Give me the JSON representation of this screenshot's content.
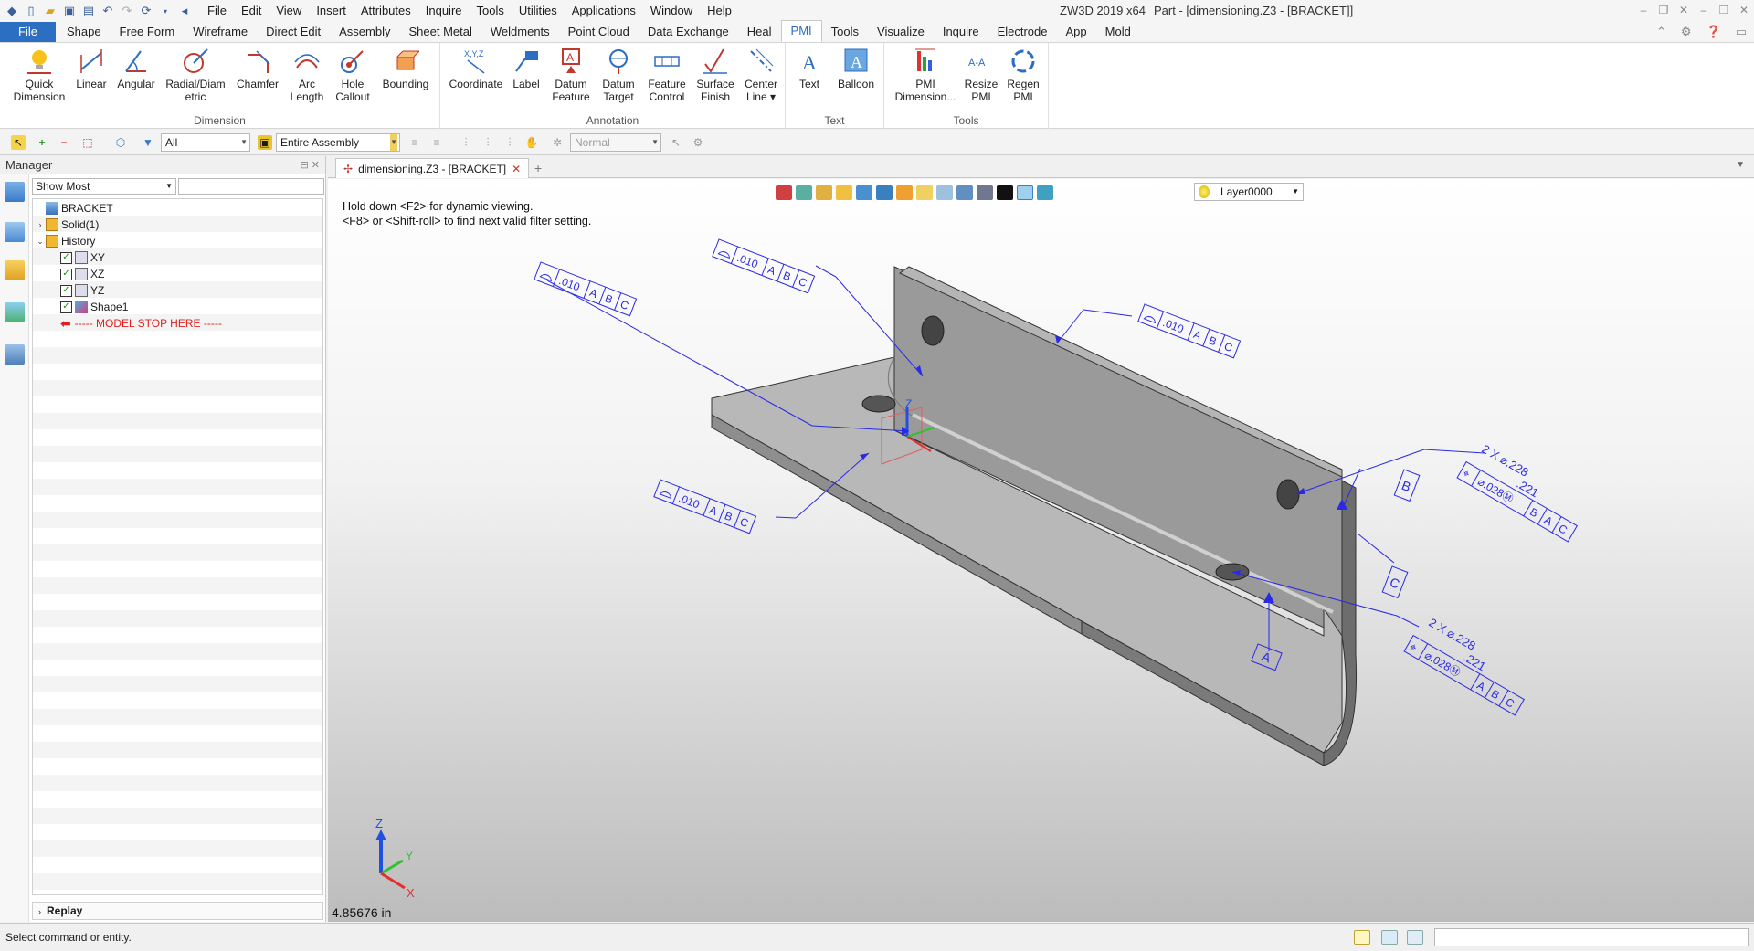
{
  "titlebar": {
    "menu": [
      "File",
      "Edit",
      "View",
      "Insert",
      "Attributes",
      "Inquire",
      "Tools",
      "Utilities",
      "Applications",
      "Window",
      "Help"
    ],
    "app_name": "ZW3D 2019  x64",
    "doc_title": "Part - [dimensioning.Z3 - [BRACKET]]"
  },
  "tabs": [
    "File",
    "Shape",
    "Free Form",
    "Wireframe",
    "Direct Edit",
    "Assembly",
    "Sheet Metal",
    "Weldments",
    "Point Cloud",
    "Data Exchange",
    "Heal",
    "PMI",
    "Tools",
    "Visualize",
    "Inquire",
    "Electrode",
    "App",
    "Mold"
  ],
  "active_tab": "PMI",
  "ribbon": {
    "dimension": {
      "label": "Dimension",
      "buttons": [
        "Quick\nDimension",
        "Linear",
        "Angular",
        "Radial/Diam\netric",
        "Chamfer",
        "Arc\nLength",
        "Hole\nCallout",
        "Bounding"
      ]
    },
    "annotation": {
      "label": "Annotation",
      "buttons": [
        "Coordinate",
        "Label",
        "Datum\nFeature",
        "Datum\nTarget",
        "Feature\nControl",
        "Surface\nFinish",
        "Center\nLine ▾"
      ]
    },
    "text": {
      "label": "Text",
      "buttons": [
        "Text",
        "Balloon"
      ]
    },
    "tools": {
      "label": "Tools",
      "buttons": [
        "PMI\nDimension...",
        "Resize\nPMI",
        "Regen\nPMI"
      ]
    }
  },
  "toolbar": {
    "filter_value": "All",
    "assembly_value": "Entire Assembly",
    "render_value": "Normal"
  },
  "manager": {
    "title": "Manager",
    "filter": "Show Most",
    "tree": {
      "root": "BRACKET",
      "solid": "Solid(1)",
      "history": "History",
      "items": [
        "XY",
        "XZ",
        "YZ",
        "Shape1"
      ],
      "stop_marker": "----- MODEL STOP HERE -----"
    },
    "replay": "Replay"
  },
  "document": {
    "tab_label": "dimensioning.Z3 - [BRACKET]"
  },
  "viewport": {
    "hint_line1": "Hold down <F2> for dynamic viewing.",
    "hint_line2": "<F8> or <Shift-roll> to find next valid filter setting.",
    "layer": "Layer0000",
    "measure": "4.85676 in",
    "fcf": [
      {
        "tol": ".010",
        "refs": [
          "A",
          "B",
          "C"
        ]
      },
      {
        "tol": ".010",
        "refs": [
          "A",
          "B",
          "C"
        ]
      },
      {
        "tol": ".010",
        "refs": [
          "A",
          "B",
          "C"
        ]
      },
      {
        "tol": ".010",
        "refs": [
          "A",
          "B",
          "C"
        ]
      }
    ],
    "datums": [
      "A",
      "B",
      "C"
    ],
    "hole_callout_1": {
      "count": "2 X ⌀.228",
      "lower": ".221",
      "fcf": "⌀.028Ⓜ",
      "refs": [
        "B",
        "A",
        "C"
      ]
    },
    "hole_callout_2": {
      "count": "2 X ⌀.228",
      "lower": ".221",
      "fcf": "⌀.028Ⓜ",
      "refs": [
        "A",
        "B",
        "C"
      ]
    },
    "triad": {
      "x": "X",
      "y": "Y",
      "z": "Z"
    }
  },
  "status": {
    "prompt": "Select command or entity."
  },
  "colors": {
    "accent": "#2c6ec2",
    "pmi": "#2a2ae6",
    "stop": "#e02020"
  }
}
